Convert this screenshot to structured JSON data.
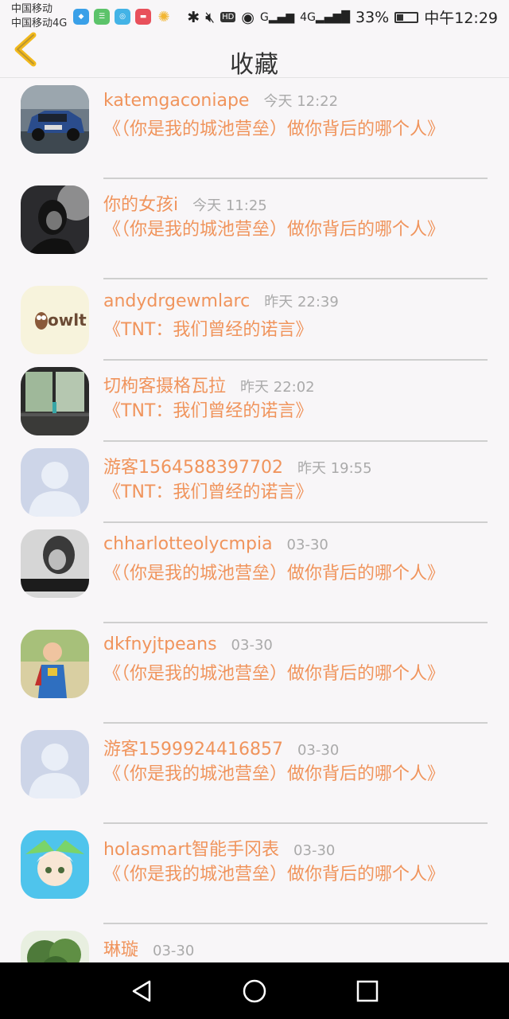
{
  "status_bar": {
    "carrier1": "中国移动",
    "carrier2": "中国移动4G",
    "signal1": "G",
    "signal2": "4G",
    "battery": "33%",
    "time": "中午12:29",
    "hd": "HD"
  },
  "header": {
    "title": "收藏"
  },
  "colors": {
    "accent": "#f0945c",
    "time": "#aaaaaa"
  },
  "items": [
    {
      "name": "katemgaconiape",
      "time": "今天 12:22",
      "message": "《（你是我的城池营垒）做你背后的哪个人》",
      "avatar": "car-photo"
    },
    {
      "name": "你的女孩i",
      "time": "今天 11:25",
      "message": "《（你是我的城池营垒）做你背后的哪个人》",
      "avatar": "girl-photo"
    },
    {
      "name": "andydrgewmlarc",
      "time": "昨天 22:39",
      "message": "《TNT：我们曾经的诺言》",
      "avatar": "owlt-logo",
      "avatar_text": "owlt"
    },
    {
      "name": "切枸客摄格瓦拉",
      "time": "昨天 22:02",
      "message": "《TNT：我们曾经的诺言》",
      "avatar": "window-photo"
    },
    {
      "name": "游客1564588397702",
      "time": "昨天 19:55",
      "message": "《TNT：我们曾经的诺言》",
      "avatar": "default-user"
    },
    {
      "name": "chharlotteolycmpia",
      "time": "03-30",
      "message": "《（你是我的城池营垒）做你背后的哪个人》",
      "avatar": "bw-photo"
    },
    {
      "name": "dkfnyjtpeans",
      "time": "03-30",
      "message": "《（你是我的城池营垒）做你背后的哪个人》",
      "avatar": "child-photo"
    },
    {
      "name": "游客1599924416857",
      "time": "03-30",
      "message": "《（你是我的城池营垒）做你背后的哪个人》",
      "avatar": "default-user"
    },
    {
      "name": "holasmart智能手冈表",
      "time": "03-30",
      "message": "《（你是我的城池营垒）做你背后的哪个人》",
      "avatar": "anime-photo"
    },
    {
      "name": "琳璇",
      "time": "03-30",
      "message": "",
      "avatar": "tree-photo"
    }
  ]
}
